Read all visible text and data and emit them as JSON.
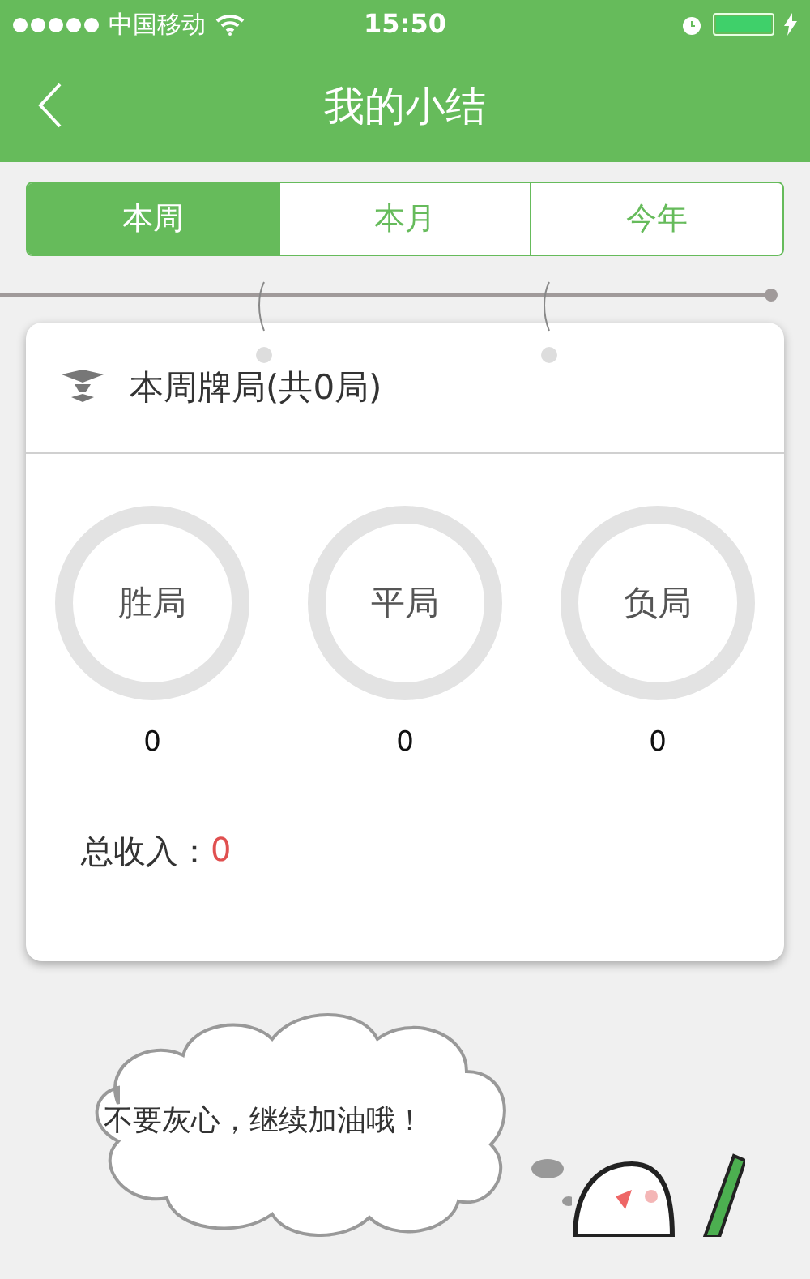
{
  "status_bar": {
    "carrier": "中国移动",
    "time": "15:50"
  },
  "nav": {
    "title": "我的小结"
  },
  "tabs": [
    {
      "label": "本周",
      "selected": true
    },
    {
      "label": "本月",
      "selected": false
    },
    {
      "label": "今年",
      "selected": false
    }
  ],
  "card": {
    "title": "本周牌局(共0局)",
    "stats": [
      {
        "label": "胜局",
        "value": "0"
      },
      {
        "label": "平局",
        "value": "0"
      },
      {
        "label": "负局",
        "value": "0"
      }
    ],
    "income_label": "总收入：",
    "income_value": "0"
  },
  "bubble": {
    "text": "不要灰心，继续加油哦！"
  }
}
